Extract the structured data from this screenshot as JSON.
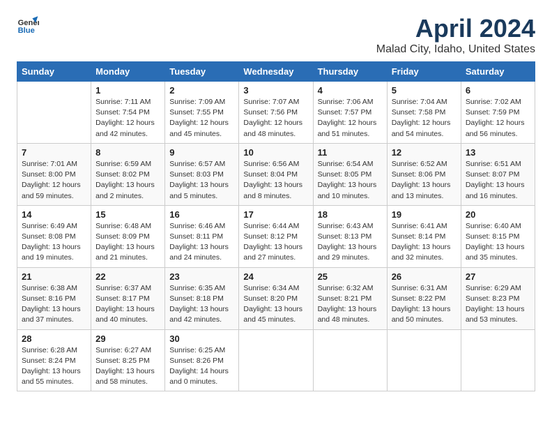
{
  "header": {
    "logo_general": "General",
    "logo_blue": "Blue",
    "title": "April 2024",
    "subtitle": "Malad City, Idaho, United States"
  },
  "weekdays": [
    "Sunday",
    "Monday",
    "Tuesday",
    "Wednesday",
    "Thursday",
    "Friday",
    "Saturday"
  ],
  "weeks": [
    [
      {
        "day": "",
        "info": ""
      },
      {
        "day": "1",
        "info": "Sunrise: 7:11 AM\nSunset: 7:54 PM\nDaylight: 12 hours\nand 42 minutes."
      },
      {
        "day": "2",
        "info": "Sunrise: 7:09 AM\nSunset: 7:55 PM\nDaylight: 12 hours\nand 45 minutes."
      },
      {
        "day": "3",
        "info": "Sunrise: 7:07 AM\nSunset: 7:56 PM\nDaylight: 12 hours\nand 48 minutes."
      },
      {
        "day": "4",
        "info": "Sunrise: 7:06 AM\nSunset: 7:57 PM\nDaylight: 12 hours\nand 51 minutes."
      },
      {
        "day": "5",
        "info": "Sunrise: 7:04 AM\nSunset: 7:58 PM\nDaylight: 12 hours\nand 54 minutes."
      },
      {
        "day": "6",
        "info": "Sunrise: 7:02 AM\nSunset: 7:59 PM\nDaylight: 12 hours\nand 56 minutes."
      }
    ],
    [
      {
        "day": "7",
        "info": "Sunrise: 7:01 AM\nSunset: 8:00 PM\nDaylight: 12 hours\nand 59 minutes."
      },
      {
        "day": "8",
        "info": "Sunrise: 6:59 AM\nSunset: 8:02 PM\nDaylight: 13 hours\nand 2 minutes."
      },
      {
        "day": "9",
        "info": "Sunrise: 6:57 AM\nSunset: 8:03 PM\nDaylight: 13 hours\nand 5 minutes."
      },
      {
        "day": "10",
        "info": "Sunrise: 6:56 AM\nSunset: 8:04 PM\nDaylight: 13 hours\nand 8 minutes."
      },
      {
        "day": "11",
        "info": "Sunrise: 6:54 AM\nSunset: 8:05 PM\nDaylight: 13 hours\nand 10 minutes."
      },
      {
        "day": "12",
        "info": "Sunrise: 6:52 AM\nSunset: 8:06 PM\nDaylight: 13 hours\nand 13 minutes."
      },
      {
        "day": "13",
        "info": "Sunrise: 6:51 AM\nSunset: 8:07 PM\nDaylight: 13 hours\nand 16 minutes."
      }
    ],
    [
      {
        "day": "14",
        "info": "Sunrise: 6:49 AM\nSunset: 8:08 PM\nDaylight: 13 hours\nand 19 minutes."
      },
      {
        "day": "15",
        "info": "Sunrise: 6:48 AM\nSunset: 8:09 PM\nDaylight: 13 hours\nand 21 minutes."
      },
      {
        "day": "16",
        "info": "Sunrise: 6:46 AM\nSunset: 8:11 PM\nDaylight: 13 hours\nand 24 minutes."
      },
      {
        "day": "17",
        "info": "Sunrise: 6:44 AM\nSunset: 8:12 PM\nDaylight: 13 hours\nand 27 minutes."
      },
      {
        "day": "18",
        "info": "Sunrise: 6:43 AM\nSunset: 8:13 PM\nDaylight: 13 hours\nand 29 minutes."
      },
      {
        "day": "19",
        "info": "Sunrise: 6:41 AM\nSunset: 8:14 PM\nDaylight: 13 hours\nand 32 minutes."
      },
      {
        "day": "20",
        "info": "Sunrise: 6:40 AM\nSunset: 8:15 PM\nDaylight: 13 hours\nand 35 minutes."
      }
    ],
    [
      {
        "day": "21",
        "info": "Sunrise: 6:38 AM\nSunset: 8:16 PM\nDaylight: 13 hours\nand 37 minutes."
      },
      {
        "day": "22",
        "info": "Sunrise: 6:37 AM\nSunset: 8:17 PM\nDaylight: 13 hours\nand 40 minutes."
      },
      {
        "day": "23",
        "info": "Sunrise: 6:35 AM\nSunset: 8:18 PM\nDaylight: 13 hours\nand 42 minutes."
      },
      {
        "day": "24",
        "info": "Sunrise: 6:34 AM\nSunset: 8:20 PM\nDaylight: 13 hours\nand 45 minutes."
      },
      {
        "day": "25",
        "info": "Sunrise: 6:32 AM\nSunset: 8:21 PM\nDaylight: 13 hours\nand 48 minutes."
      },
      {
        "day": "26",
        "info": "Sunrise: 6:31 AM\nSunset: 8:22 PM\nDaylight: 13 hours\nand 50 minutes."
      },
      {
        "day": "27",
        "info": "Sunrise: 6:29 AM\nSunset: 8:23 PM\nDaylight: 13 hours\nand 53 minutes."
      }
    ],
    [
      {
        "day": "28",
        "info": "Sunrise: 6:28 AM\nSunset: 8:24 PM\nDaylight: 13 hours\nand 55 minutes."
      },
      {
        "day": "29",
        "info": "Sunrise: 6:27 AM\nSunset: 8:25 PM\nDaylight: 13 hours\nand 58 minutes."
      },
      {
        "day": "30",
        "info": "Sunrise: 6:25 AM\nSunset: 8:26 PM\nDaylight: 14 hours\nand 0 minutes."
      },
      {
        "day": "",
        "info": ""
      },
      {
        "day": "",
        "info": ""
      },
      {
        "day": "",
        "info": ""
      },
      {
        "day": "",
        "info": ""
      }
    ]
  ]
}
